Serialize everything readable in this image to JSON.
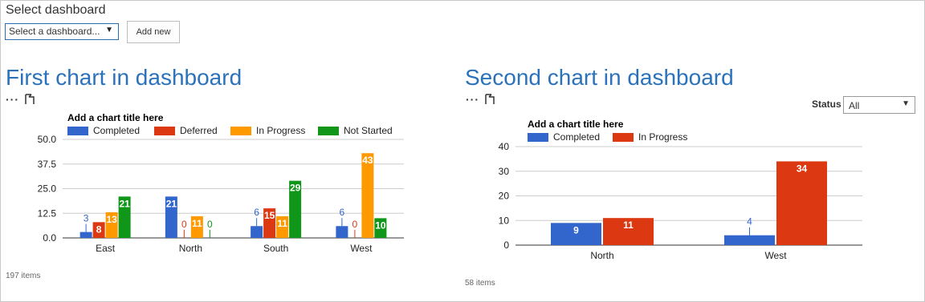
{
  "header": {
    "select_label": "Select dashboard",
    "select_value": "Select a dashboard...",
    "add_new_label": "Add new"
  },
  "toolbar": {
    "ellipsis": "···"
  },
  "colors": {
    "accent": "#2b72bb",
    "completed": "#3366cc",
    "deferred": "#dc3912",
    "in_progress": "#ff9900",
    "not_started": "#109618"
  },
  "charts": [
    {
      "heading": "First chart in dashboard",
      "items_count": "197 items"
    },
    {
      "heading": "Second chart in dashboard",
      "items_count": "58 items",
      "filter": {
        "label": "Status",
        "value": "All"
      }
    }
  ],
  "chart_data": [
    {
      "type": "bar",
      "title": "Add a chart title here",
      "categories": [
        "East",
        "North",
        "South",
        "West"
      ],
      "series": [
        {
          "name": "Completed",
          "color": "#3366cc",
          "values": [
            3,
            21,
            6,
            6
          ]
        },
        {
          "name": "Deferred",
          "color": "#dc3912",
          "values": [
            8,
            0,
            15,
            0
          ]
        },
        {
          "name": "In Progress",
          "color": "#ff9900",
          "values": [
            13,
            11,
            11,
            43
          ]
        },
        {
          "name": "Not Started",
          "color": "#109618",
          "values": [
            21,
            0,
            29,
            10
          ]
        }
      ],
      "yticks": [
        "0.0",
        "12.5",
        "25.0",
        "37.5",
        "50.0"
      ],
      "ylim": [
        0,
        50
      ],
      "legend": "top",
      "grid": true
    },
    {
      "type": "bar",
      "title": "Add a chart title here",
      "categories": [
        "North",
        "West"
      ],
      "series": [
        {
          "name": "Completed",
          "color": "#3366cc",
          "values": [
            9,
            4
          ]
        },
        {
          "name": "In Progress",
          "color": "#dc3912",
          "values": [
            11,
            34
          ]
        }
      ],
      "yticks": [
        "0",
        "10",
        "20",
        "30",
        "40"
      ],
      "ylim": [
        0,
        40
      ],
      "legend": "top",
      "grid": true
    }
  ]
}
